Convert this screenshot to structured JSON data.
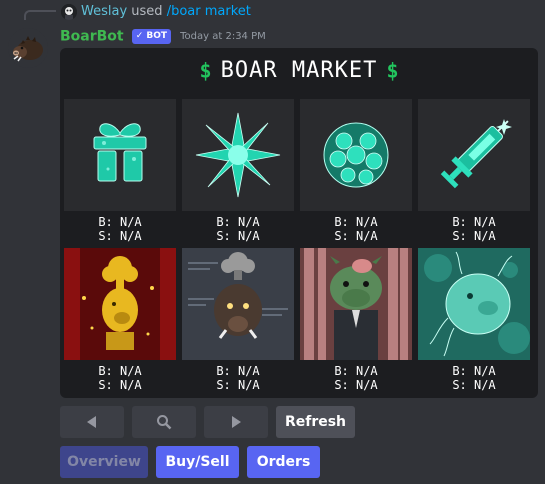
{
  "reply": {
    "user": "Weslay",
    "used_text": "used",
    "command": "/boar market"
  },
  "message": {
    "bot_name": "BoarBot",
    "bot_tag": "✓ BOT",
    "timestamp": "Today at 2:34 PM"
  },
  "embed": {
    "title": "BOAR MARKET",
    "dollar_symbol": "$",
    "items": [
      {
        "icon": "gift-icon",
        "buy": "B: N/A",
        "sell": "S: N/A"
      },
      {
        "icon": "crystal-burst-icon",
        "buy": "B: N/A",
        "sell": "S: N/A"
      },
      {
        "icon": "crystal-orb-icon",
        "buy": "B: N/A",
        "sell": "S: N/A"
      },
      {
        "icon": "syringe-icon",
        "buy": "B: N/A",
        "sell": "S: N/A"
      },
      {
        "icon": "golden-boar-icon",
        "buy": "B: N/A",
        "sell": "S: N/A"
      },
      {
        "icon": "nuclear-boar-icon",
        "buy": "B: N/A",
        "sell": "S: N/A"
      },
      {
        "icon": "zombie-boar-icon",
        "buy": "B: N/A",
        "sell": "S: N/A"
      },
      {
        "icon": "microbe-boar-icon",
        "buy": "B: N/A",
        "sell": "S: N/A"
      }
    ]
  },
  "buttons": {
    "prev_icon": "left-arrow-icon",
    "search_icon": "magnifier-icon",
    "next_icon": "right-arrow-icon",
    "refresh": "Refresh",
    "overview": "Overview",
    "buy_sell": "Buy/Sell",
    "orders": "Orders"
  },
  "colors": {
    "background": "#313338",
    "embed": "#1c1d20",
    "bot_name": "#3fb950",
    "dollar": "#22c55e",
    "blurple": "#5865f2",
    "grey_button": "#4e5058",
    "link": "#00a8fc"
  }
}
